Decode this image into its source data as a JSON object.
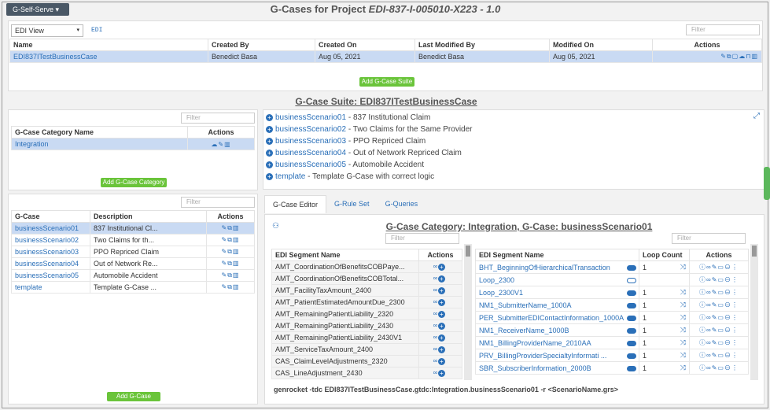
{
  "topbar": {
    "menu_label": "G-Self-Serve ▾"
  },
  "page": {
    "title_prefix": "G-Cases for Project ",
    "title_project": "EDI-837-I-005010-X223 - 1.0"
  },
  "project_panel": {
    "view_select": "EDI View",
    "edi_link": "EDI",
    "filter_placeholder": "Filter",
    "columns": [
      "Name",
      "Created By",
      "Created On",
      "Last Modified By",
      "Modified On",
      "Actions"
    ],
    "row": {
      "name": "EDI837ITestBusinessCase",
      "created_by": "Benedict Basa",
      "created_on": "Aug 05, 2021",
      "modified_by": "Benedict Basa",
      "modified_on": "Aug 05, 2021"
    },
    "add_suite_label": "Add G-Case Suite"
  },
  "suite": {
    "title": "G-Case Suite: EDI837ITestBusinessCase",
    "scenarios": [
      {
        "name": "businessScenario01",
        "desc": " - 837 Institutional Claim"
      },
      {
        "name": "businessScenario02",
        "desc": " - Two Claims for the Same Provider"
      },
      {
        "name": "businessScenario03",
        "desc": " - PPO Repriced Claim"
      },
      {
        "name": "businessScenario04",
        "desc": " - Out of Network Repriced Claim"
      },
      {
        "name": "businessScenario05",
        "desc": " - Automobile Accident"
      },
      {
        "name": "template",
        "desc": " - Template G-Case with correct logic"
      }
    ]
  },
  "category_panel": {
    "filter_placeholder": "Filter",
    "col_name": "G-Case Category Name",
    "col_actions": "Actions",
    "row": "Integration",
    "add_label": "Add G-Case Category"
  },
  "gcase_panel": {
    "filter_placeholder": "Filter",
    "col_case": "G-Case",
    "col_desc": "Description",
    "col_actions": "Actions",
    "rows": [
      {
        "name": "businessScenario01",
        "desc": "837 Institutional Cl..."
      },
      {
        "name": "businessScenario02",
        "desc": "Two Claims for th..."
      },
      {
        "name": "businessScenario03",
        "desc": "PPO Repriced Claim"
      },
      {
        "name": "businessScenario04",
        "desc": "Out of Network Re..."
      },
      {
        "name": "businessScenario05",
        "desc": "Automobile Accident"
      },
      {
        "name": "template",
        "desc": "Template G-Case ..."
      }
    ],
    "add_label": "Add G-Case"
  },
  "tabs": [
    "G-Case Editor",
    "G-Rule Set",
    "G-Queries"
  ],
  "editor": {
    "title": "G-Case Category: Integration, G-Case: businessScenario01",
    "left_filter": "Filter",
    "right_filter": "Filter",
    "left_cols": [
      "EDI Segment Name",
      "Actions"
    ],
    "left_rows": [
      "AMT_CoordinationOfBenefitsCOBPaye...",
      "AMT_CoordinationOfBenefitsCOBTotal...",
      "AMT_FacilityTaxAmount_2400",
      "AMT_PatientEstimatedAmountDue_2300",
      "AMT_RemainingPatientLiability_2320",
      "AMT_RemainingPatientLiability_2430",
      "AMT_RemainingPatientLiability_2430V1",
      "AMT_ServiceTaxAmount_2400",
      "CAS_ClaimLevelAdjustments_2320",
      "CAS_LineAdjustment_2430"
    ],
    "right_cols": [
      "EDI Segment Name",
      "Loop Count",
      "Actions"
    ],
    "right_rows": [
      {
        "name": "BHT_BeginningOfHierarchicalTransaction",
        "count": "1",
        "toggle": "on",
        "shuffle": true
      },
      {
        "name": "Loop_2300",
        "count": "",
        "toggle": "off",
        "shuffle": false
      },
      {
        "name": "Loop_2300V1",
        "count": "1",
        "toggle": "on",
        "shuffle": true
      },
      {
        "name": "NM1_SubmitterName_1000A",
        "count": "1",
        "toggle": "on",
        "shuffle": true
      },
      {
        "name": "PER_SubmitterEDIContactInformation_1000A",
        "count": "1",
        "toggle": "on",
        "shuffle": true
      },
      {
        "name": "NM1_ReceiverName_1000B",
        "count": "1",
        "toggle": "on",
        "shuffle": true
      },
      {
        "name": "NM1_BillingProviderName_2010AA",
        "count": "1",
        "toggle": "on",
        "shuffle": true
      },
      {
        "name": "PRV_BillingProviderSpecialtyInformati ...",
        "count": "1",
        "toggle": "on",
        "shuffle": true
      },
      {
        "name": "SBR_SubscriberInformation_2000B",
        "count": "1",
        "toggle": "on",
        "shuffle": true
      }
    ],
    "command": "genrocket -tdc EDI837ITestBusinessCase.gtdc:Integration.businessScenario01 -r <ScenarioName.grs>"
  }
}
